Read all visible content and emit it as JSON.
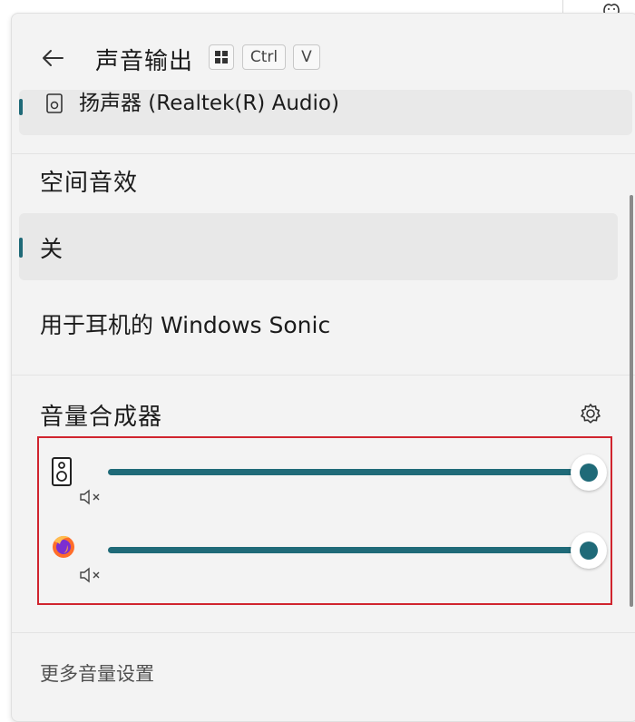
{
  "header": {
    "title": "声音输出",
    "shortcut_keys": [
      "⊞",
      "Ctrl",
      "V"
    ]
  },
  "device": {
    "label": "扬声器 (Realtek(R) Audio)"
  },
  "spatial_sound": {
    "title": "空间音效",
    "options": [
      {
        "label": "关",
        "selected": true
      },
      {
        "label": "用于耳机的 Windows Sonic",
        "selected": false
      }
    ]
  },
  "mixer": {
    "title": "音量合成器",
    "apps": [
      {
        "name": "speaker-app",
        "mute_glyph": "🔇︎×",
        "level": 1.0
      },
      {
        "name": "firefox-app",
        "mute_glyph": "🔇︎×",
        "level": 1.0
      }
    ]
  },
  "footer": {
    "more_settings": "更多音量设置"
  },
  "colors": {
    "accent": "#1f6a78",
    "highlight_box": "#d0242e",
    "panel_bg": "#f3f3f3"
  }
}
